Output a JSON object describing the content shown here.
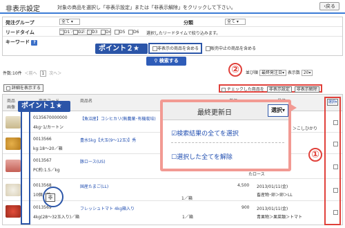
{
  "header": {
    "title": "非表示設定",
    "description": "対象の商品を選択し「非表示設定」または「非表示解除」をクリックして下さい。",
    "back_label": "戻る"
  },
  "filters": {
    "group_label": "発注グループ",
    "group_value": "全て",
    "category_label": "分類",
    "category_value": "全て",
    "leadtime_label": "リードタイム",
    "leadtime_options": [
      "D1",
      "D2",
      "D3",
      "D4",
      "D5",
      "D6"
    ],
    "leadtime_note": "選択したリードタイムで絞り込みます。",
    "keyword_label": "キーワード",
    "keyword_placeholder": "キーワードを入力",
    "include_hidden_label": "非表示の商品を含める",
    "include_discontinued_label": "販売中止の商品を含める",
    "search_label": "検索する"
  },
  "callouts": {
    "point2": "ポイント２★",
    "point1": "ポイント１★",
    "num1": "①",
    "num2": "②"
  },
  "pager": {
    "count_text": "件数:10件",
    "prev": "＜前へ",
    "page": "1",
    "next": "次へ＞"
  },
  "sort": {
    "order_label": "並び順",
    "order_value": "最終発注日",
    "display_label": "表示数",
    "display_value": "20"
  },
  "toolbar": {
    "detail_label": "詳細を表示する",
    "checked_label": "チェックした商品を",
    "hide_label": "非表示設定",
    "unhide_label": "非表示解除"
  },
  "table": {
    "headers": {
      "image": "商品\n画像",
      "code": "商品コード",
      "name": "商品名",
      "price": "単価",
      "last_order": "最終",
      "select": "選択"
    },
    "rows": [
      {
        "code": "0135670000000",
        "spec": "4kg･1/カートン",
        "name": "【魚沼産】コシヒカリ(無農薬･有機栽培)",
        "extra": "＞こしひかり"
      },
      {
        "code": "0013566",
        "spec": "kg:18〜20／箱",
        "name": "豊水5kg【大玉(9〜12玉)】秀",
        "extra": ""
      },
      {
        "code": "0013567",
        "spec": "PC約:1.5／kg",
        "name": "豚ロース(US)",
        "extra": ""
      },
      {
        "code": "0013568",
        "spec": "10個／箱",
        "name": "国産たまご(LL)",
        "unit": "",
        "price": "4,500",
        "date": "2013/01/11(金)",
        "category": "畜産物･卵＞卵＞LL",
        "extra_top": "たロース"
      },
      {
        "code": "0013569",
        "spec": "4kg(28〜32玉入り)／箱",
        "name": "フレッシュトマト 4kg箱入り",
        "unit": "1／箱",
        "price": "900",
        "date": "2013/01/11(金)",
        "category": "青果物＞果菜類＞トマト"
      }
    ]
  },
  "popup": {
    "title": "最終更新日",
    "select_label": "選択▾",
    "item1": "検索結果の全てを選択",
    "item2": "選択した全てを解除"
  },
  "hidden_badge": "非",
  "select_col_label": "選択▾",
  "colors": {
    "accent_blue": "#2b55a8",
    "highlight_red": "#e0403a",
    "popup_border": "#f29a93"
  }
}
